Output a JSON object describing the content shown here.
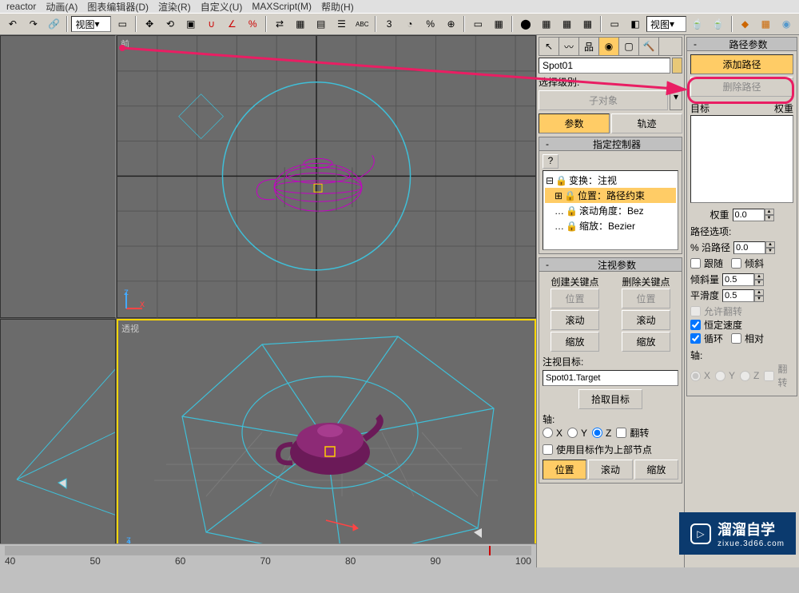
{
  "menu": {
    "reactor": "reactor",
    "anim": "动画(A)",
    "grapheditor": "图表编辑器(D)",
    "render": "渲染(R)",
    "custom": "自定义(U)",
    "maxscript": "MAXScript(M)",
    "help": "帮助(H)"
  },
  "toolbar": {
    "view_dropdown1": "视图",
    "view_dropdown2": "视图"
  },
  "viewports": {
    "top_right_label": "前",
    "bottom_right_label": "透视"
  },
  "object_name": "Spot01",
  "selection": {
    "level_label": "选择级别:",
    "sub_object": "子对象"
  },
  "main_buttons": {
    "params": "参数",
    "tracks": "轨迹"
  },
  "assign_controller": {
    "header": "指定控制器",
    "tree_root": "变换：注视",
    "tree_pos": "位置：路径约束",
    "tree_rot": "滚动角度：Bez",
    "tree_scale": "缩放：Bezier"
  },
  "lookat_params": {
    "header": "注视参数",
    "create_key": "创建关键点",
    "delete_key": "删除关键点",
    "position": "位置",
    "roll": "滚动",
    "scale": "缩放",
    "target_label": "注视目标:",
    "target_value": "Spot01.Target",
    "pick_target": "拾取目标",
    "axis_label": "轴:",
    "x": "X",
    "y": "Y",
    "z": "Z",
    "flip": "翻转",
    "use_target_upnode": "使用目标作为上部节点",
    "btn_pos": "位置",
    "btn_roll": "滚动",
    "btn_scale": "缩放"
  },
  "path_params": {
    "header": "路径参数",
    "add_path": "添加路径",
    "delete_path": "删除路径",
    "target": "目标",
    "weight_col": "权重",
    "weight_label": "权重",
    "weight_value": "0.0",
    "options_label": "路径选项:",
    "percent_label": "% 沿路径",
    "percent_value": "0.0",
    "follow": "跟随",
    "bank": "倾斜",
    "bank_amount": "倾斜量",
    "bank_amount_value": "0.5",
    "smoothness": "平滑度",
    "smoothness_value": "0.5",
    "allow_flip": "允许翻转",
    "constant_vel": "恒定速度",
    "loop": "循环",
    "relative": "相对",
    "axis_label": "轴:",
    "x": "X",
    "y": "Y",
    "z": "Z",
    "flip": "翻转"
  },
  "timeline": {
    "marks": [
      "40",
      "50",
      "60",
      "70",
      "80",
      "90",
      "100"
    ]
  },
  "watermark": {
    "title": "溜溜自学",
    "subtitle": "zixue.3d66.com"
  }
}
